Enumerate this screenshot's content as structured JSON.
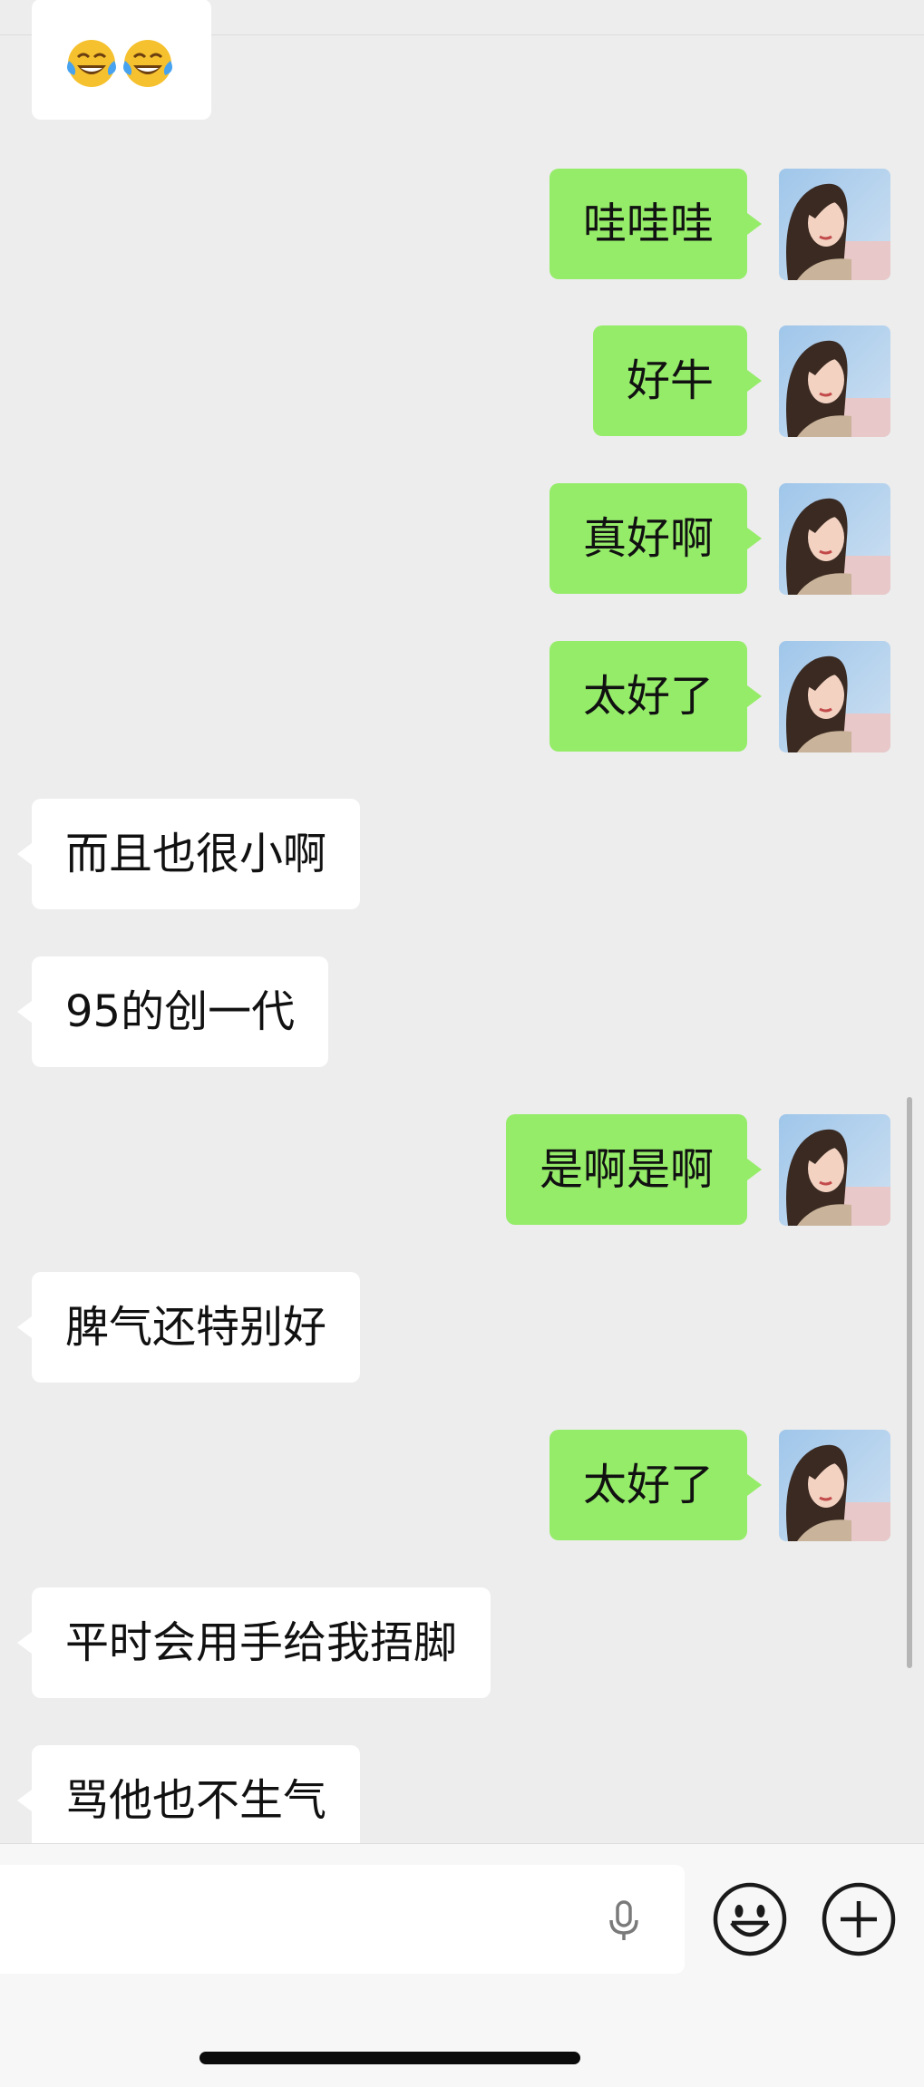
{
  "app": "WeChat chat",
  "colors": {
    "sent_bubble": "#95ec69",
    "received_bubble": "#ffffff",
    "background": "#ededed"
  },
  "messages": [
    {
      "side": "left",
      "text": "",
      "icon": "tears-of-joy-emoji x2"
    },
    {
      "side": "right",
      "text": "哇哇哇"
    },
    {
      "side": "right",
      "text": "好牛"
    },
    {
      "side": "right",
      "text": "真好啊"
    },
    {
      "side": "right",
      "text": "太好了"
    },
    {
      "side": "left",
      "text": "而且也很小啊"
    },
    {
      "side": "left",
      "text": "95的创一代"
    },
    {
      "side": "right",
      "text": "是啊是啊"
    },
    {
      "side": "left",
      "text": "脾气还特别好"
    },
    {
      "side": "right",
      "text": "太好了"
    },
    {
      "side": "left",
      "text": "平时会用手给我捂脚"
    },
    {
      "side": "left",
      "text": "骂他也不生气"
    }
  ],
  "input_bar": {
    "text_value": "",
    "icons": [
      "microphone-icon",
      "emoji-icon",
      "plus-icon"
    ]
  }
}
